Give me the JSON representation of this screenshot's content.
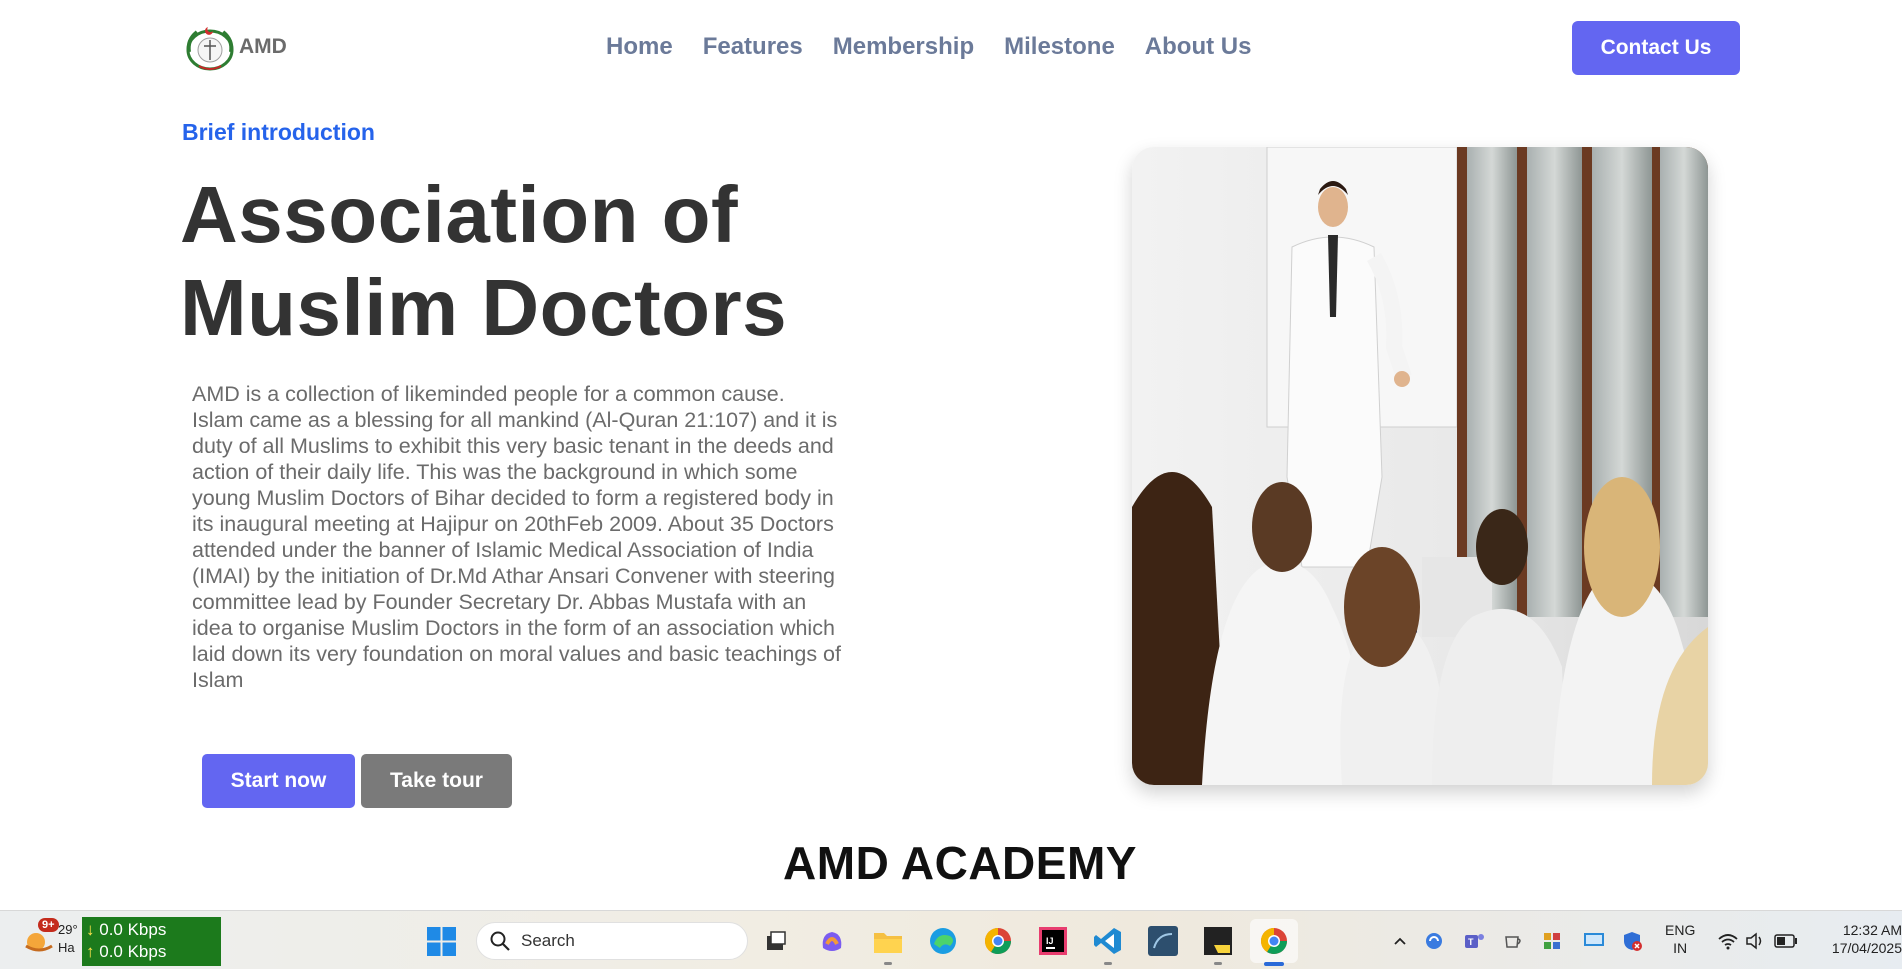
{
  "nav": {
    "logo_text": "AMD",
    "links": [
      "Home",
      "Features",
      "Membership",
      "Milestone",
      "About Us"
    ],
    "contact_label": "Contact Us"
  },
  "hero": {
    "eyebrow": "Brief introduction",
    "title_line1": "Association of",
    "title_line2": "Muslim Doctors",
    "body": "AMD is a collection of likeminded people for a common cause. Islam came as a blessing for all mankind (Al-Quran 21:107) and it is duty of all Muslims to exhibit this very basic tenant in the deeds and action of their daily life. This was the background in which some young Muslim Doctors of Bihar decided to form a registered body in its inaugural meeting at Hajipur on 20thFeb 2009. About 35 Doctors attended under the banner of Islamic Medical Association of India (IMAI) by the initiation of Dr.Md Athar Ansari Convener with steering committee lead by Founder Secretary Dr. Abbas Mustafa with an idea to organise Muslim Doctors in the form of an association which laid down its very foundation on moral values and basic teachings of Islam",
    "start_label": "Start now",
    "tour_label": "Take tour",
    "image_icon": "lecture-photo"
  },
  "section": {
    "title": "AMD ACADEMY"
  },
  "taskbar": {
    "notification_count": "9+",
    "weather_temp": "29°",
    "weather_desc": "Ha",
    "net_down": "0.0 Kbps",
    "net_up": "0.0 Kbps",
    "search_placeholder": "Search",
    "lang_line1": "ENG",
    "lang_line2": "IN",
    "time": "12:32 AM",
    "date": "17/04/2025",
    "colors": {
      "accent": "#6366f1",
      "link": "#2563eb",
      "net_bg": "#1c7a1c"
    }
  }
}
